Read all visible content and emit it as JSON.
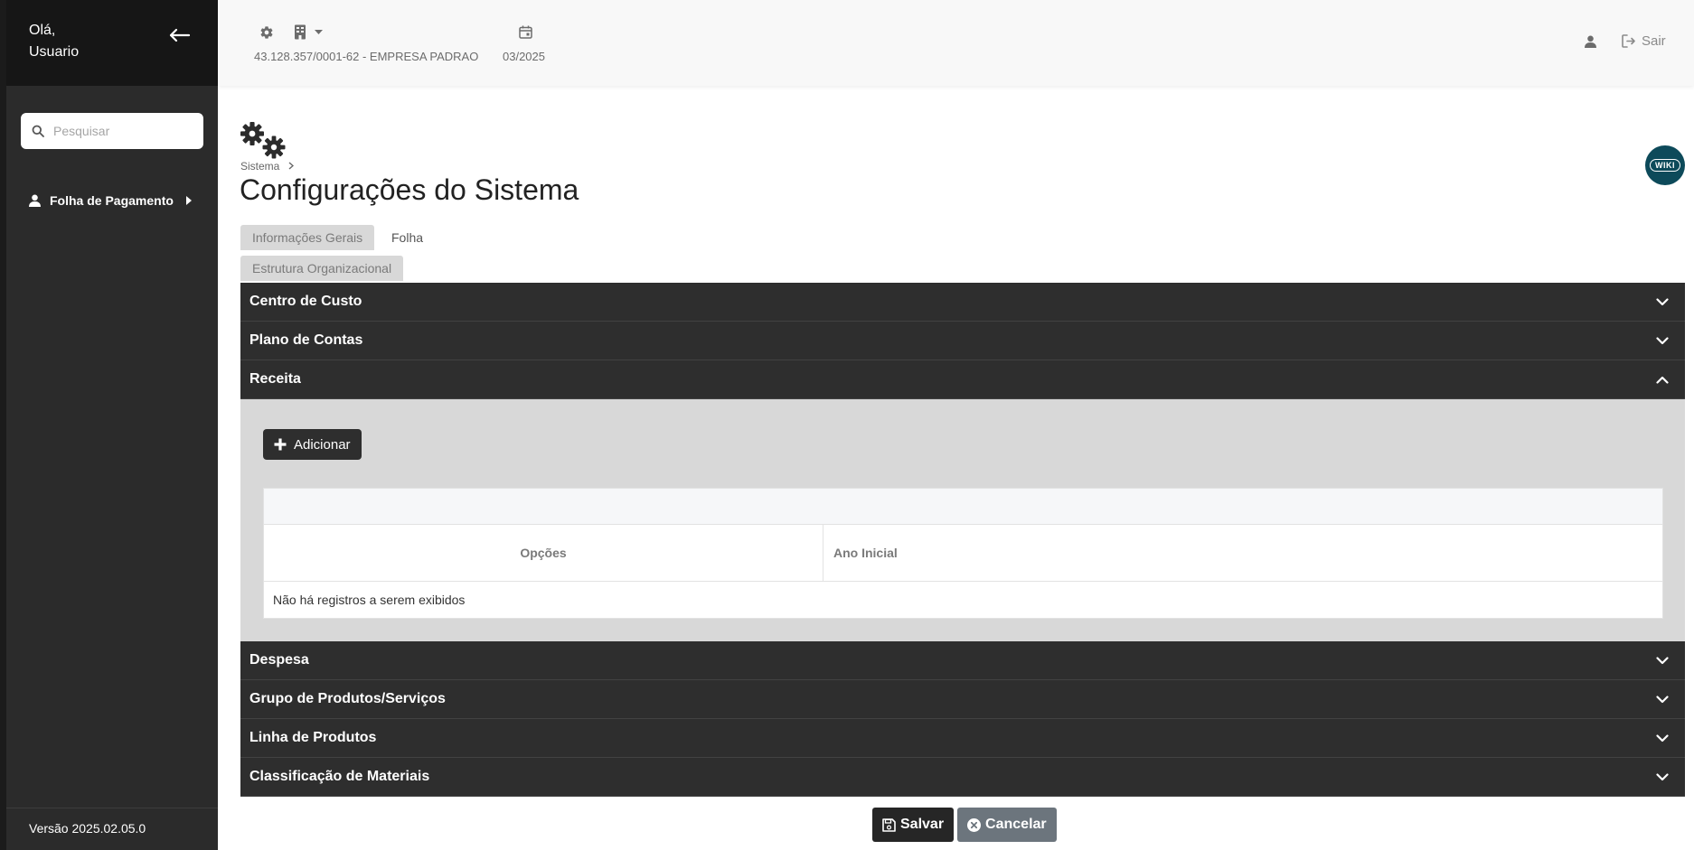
{
  "sidebar": {
    "greeting_line1": "Olá,",
    "greeting_line2": "Usuario",
    "search_placeholder": "Pesquisar",
    "nav_items": [
      {
        "label": "Folha de Pagamento",
        "icon": "user-icon"
      }
    ],
    "version": "Versão 2025.02.05.0"
  },
  "topbar": {
    "company": "43.128.357/0001-62 - EMPRESA PADRAO",
    "period": "03/2025",
    "logout_label": "Sair"
  },
  "page": {
    "breadcrumb": "Sistema",
    "title": "Configurações do Sistema",
    "wiki_label": "WIKI",
    "tabs": [
      {
        "label": "Informações Gerais"
      },
      {
        "label": "Folha"
      },
      {
        "label": "Estrutura Organizacional"
      }
    ]
  },
  "accordion": {
    "sections": [
      {
        "label": "Centro de Custo",
        "expanded": false
      },
      {
        "label": "Plano de Contas",
        "expanded": false
      },
      {
        "label": "Receita",
        "expanded": true
      },
      {
        "label": "Despesa",
        "expanded": false
      },
      {
        "label": "Grupo de Produtos/Serviços",
        "expanded": false
      },
      {
        "label": "Linha de Produtos",
        "expanded": false
      },
      {
        "label": "Classificação de Materiais",
        "expanded": false
      }
    ],
    "receita": {
      "add_label": "Adicionar",
      "columns": [
        "Opções",
        "Ano Inicial"
      ],
      "empty_message": "Não há registros a serem exibidos"
    }
  },
  "footer": {
    "save_label": "Salvar",
    "cancel_label": "Cancelar"
  },
  "colors": {
    "sidebar_bg": "#2b2b2b",
    "accordion_bg": "#2e2e2e",
    "wiki_bg": "#0d4a5a",
    "cancel_bg": "#6c757d"
  }
}
